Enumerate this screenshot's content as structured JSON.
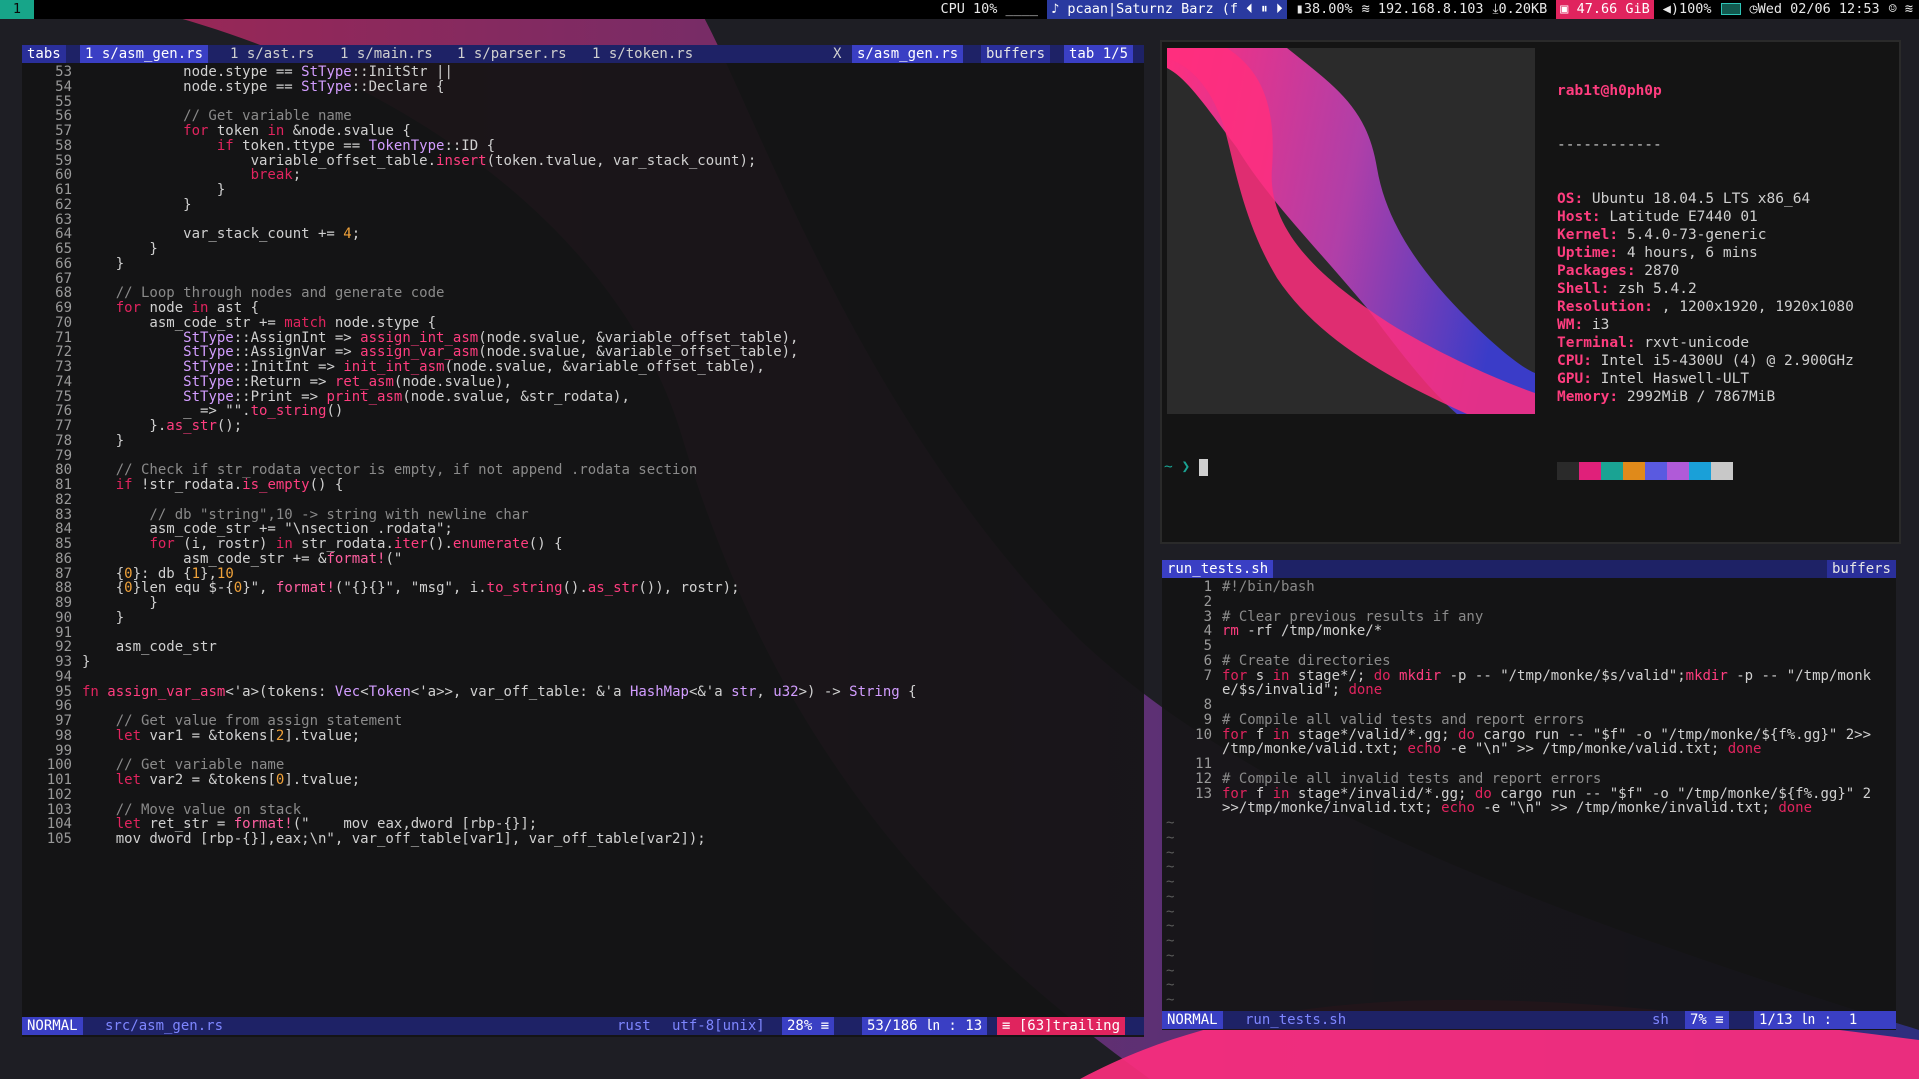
{
  "topbar": {
    "workspace": "1",
    "cpu": "CPU 10%",
    "cpu_graph": "____",
    "music": "♪ pcaan|Saturnz Barz (f",
    "battery_pct": "38.00%",
    "ip": "192.168.8.103",
    "net": "0.20KB",
    "memory": "47.66 GiB",
    "volume": "100%",
    "datetime": "Wed 02/06 12:53"
  },
  "editor": {
    "tabline": {
      "tabs_label": "tabs",
      "tabs": [
        "1 s/asm_gen.rs",
        "1 s/ast.rs",
        "1 s/main.rs",
        "1 s/parser.rs",
        "1 s/token.rs"
      ],
      "close": "X",
      "current": "s/asm_gen.rs",
      "buffers": "buffers",
      "tab_count": "tab 1/5"
    },
    "lines": [
      [
        "53",
        "            node.stype == StType::InitStr ||"
      ],
      [
        "54",
        "            node.stype == StType::Declare {"
      ],
      [
        "55",
        ""
      ],
      [
        "56",
        "            // Get variable name"
      ],
      [
        "57",
        "            for token in &node.svalue {"
      ],
      [
        "58",
        "                if token.ttype == TokenType::ID {"
      ],
      [
        "59",
        "                    variable_offset_table.insert(token.tvalue, var_stack_count);"
      ],
      [
        "60",
        "                    break;"
      ],
      [
        "61",
        "                }"
      ],
      [
        "62",
        "            }"
      ],
      [
        "63",
        ""
      ],
      [
        "64",
        "            var_stack_count += 4;"
      ],
      [
        "65",
        "        }"
      ],
      [
        "66",
        "    }"
      ],
      [
        "67",
        ""
      ],
      [
        "68",
        "    // Loop through nodes and generate code"
      ],
      [
        "69",
        "    for node in ast {"
      ],
      [
        "70",
        "        asm_code_str += match node.stype {"
      ],
      [
        "71",
        "            StType::AssignInt => assign_int_asm(node.svalue, &variable_offset_table),"
      ],
      [
        "72",
        "            StType::AssignVar => assign_var_asm(node.svalue, &variable_offset_table),"
      ],
      [
        "73",
        "            StType::InitInt => init_int_asm(node.svalue, &variable_offset_table),"
      ],
      [
        "74",
        "            StType::Return => ret_asm(node.svalue),"
      ],
      [
        "75",
        "            StType::Print => print_asm(node.svalue, &str_rodata),"
      ],
      [
        "76",
        "            _ => \"\".to_string()"
      ],
      [
        "77",
        "        }.as_str();"
      ],
      [
        "78",
        "    }"
      ],
      [
        "79",
        ""
      ],
      [
        "80",
        "    // Check if str_rodata vector is empty, if not append .rodata section"
      ],
      [
        "81",
        "    if !str_rodata.is_empty() {"
      ],
      [
        "82",
        ""
      ],
      [
        "83",
        "        // db \"string\",10 -> string with newline char"
      ],
      [
        "84",
        "        asm_code_str += \"\\nsection .rodata\";"
      ],
      [
        "85",
        "        for (i, rostr) in str_rodata.iter().enumerate() {"
      ],
      [
        "86",
        "            asm_code_str += &format!(\""
      ],
      [
        "87",
        "    {0}: db {1},10"
      ],
      [
        "88",
        "    {0}len equ $-{0}\", format!(\"{}{}\", \"msg\", i.to_string().as_str()), rostr);"
      ],
      [
        "89",
        "        }"
      ],
      [
        "90",
        "    }"
      ],
      [
        "91",
        ""
      ],
      [
        "92",
        "    asm_code_str"
      ],
      [
        "93",
        "}"
      ],
      [
        "94",
        ""
      ],
      [
        "95",
        "fn assign_var_asm<'a>(tokens: Vec<Token<'a>>, var_off_table: &'a HashMap<&'a str, u32>) -> String {"
      ],
      [
        "96",
        ""
      ],
      [
        "97",
        "    // Get value from assign statement"
      ],
      [
        "98",
        "    let var1 = &tokens[2].tvalue;"
      ],
      [
        "99",
        ""
      ],
      [
        "100",
        "    // Get variable name"
      ],
      [
        "101",
        "    let var2 = &tokens[0].tvalue;"
      ],
      [
        "102",
        ""
      ],
      [
        "103",
        "    // Move value on stack"
      ],
      [
        "104",
        "    let ret_str = format!(\"    mov eax,dword [rbp-{}];"
      ],
      [
        "105",
        "    mov dword [rbp-{}],eax;\\n\", var_off_table[var1], var_off_table[var2]);"
      ]
    ],
    "status": {
      "mode": "NORMAL",
      "file": "src/asm_gen.rs",
      "filetype": "rust",
      "encoding": "utf-8[unix]",
      "percent": "28% ≡",
      "position": "53/186 ㏑ : 13",
      "trailing": "≡ [63]trailing"
    }
  },
  "neofetch": {
    "user": "rab1t@h0ph0p",
    "sep": "------------",
    "items": [
      {
        "k": "OS:",
        "v": " Ubuntu 18.04.5 LTS x86_64"
      },
      {
        "k": "Host:",
        "v": " Latitude E7440 01"
      },
      {
        "k": "Kernel:",
        "v": " 5.4.0-73-generic"
      },
      {
        "k": "Uptime:",
        "v": " 4 hours, 6 mins"
      },
      {
        "k": "Packages:",
        "v": " 2870"
      },
      {
        "k": "Shell:",
        "v": " zsh 5.4.2"
      },
      {
        "k": "Resolution:",
        "v": " , 1200x1920, 1920x1080"
      },
      {
        "k": "WM:",
        "v": " i3"
      },
      {
        "k": "Terminal:",
        "v": " rxvt-unicode"
      },
      {
        "k": "CPU:",
        "v": " Intel i5-4300U (4) @ 2.900GHz"
      },
      {
        "k": "GPU:",
        "v": " Intel Haswell-ULT"
      },
      {
        "k": "Memory:",
        "v": " 2992MiB / 7867MiB"
      }
    ],
    "palette": [
      "#2a2a2a",
      "#e0207a",
      "#1aa393",
      "#e08a1a",
      "#5a5ae0",
      "#b05ad8",
      "#1aa0d8",
      "#c8c8c8"
    ],
    "prompt": "~ ❯"
  },
  "editor2": {
    "filename_tab": "run_tests.sh",
    "buffers": "buffers",
    "lines": [
      [
        "1",
        "#!/bin/bash"
      ],
      [
        "2",
        ""
      ],
      [
        "3",
        "# Clear previous results if any"
      ],
      [
        "4",
        "rm -rf /tmp/monke/*"
      ],
      [
        "5",
        ""
      ],
      [
        "6",
        "# Create directories"
      ],
      [
        "7",
        "for s in stage*/; do mkdir -p -- \"/tmp/monke/$s/valid\";mkdir -p -- \"/tmp/monk"
      ],
      [
        "",
        "e/$s/invalid\"; done"
      ],
      [
        "8",
        ""
      ],
      [
        "9",
        "# Compile all valid tests and report errors"
      ],
      [
        "10",
        "for f in stage*/valid/*.gg; do cargo run -- \"$f\" -o \"/tmp/monke/${f%.gg}\" 2>>"
      ],
      [
        "",
        "/tmp/monke/valid.txt; echo -e \"\\n\" >> /tmp/monke/valid.txt; done"
      ],
      [
        "11",
        ""
      ],
      [
        "12",
        "# Compile all invalid tests and report errors"
      ],
      [
        "13",
        "for f in stage*/invalid/*.gg; do cargo run -- \"$f\" -o \"/tmp/monke/${f%.gg}\" 2"
      ],
      [
        "",
        ">>/tmp/monke/invalid.txt; echo -e \"\\n\" >> /tmp/monke/invalid.txt; done"
      ]
    ],
    "tilde": "~",
    "status": {
      "mode": "NORMAL",
      "file": "run_tests.sh",
      "filetype": "sh",
      "percent": "7% ≡",
      "position": "1/13 ㏑ :  1"
    }
  }
}
